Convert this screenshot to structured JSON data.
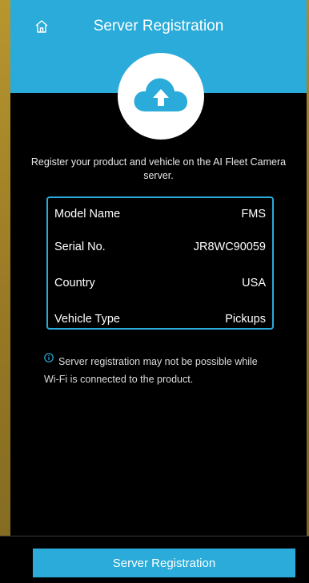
{
  "header": {
    "title": "Server Registration",
    "home_icon": "home-icon"
  },
  "upload_icon": "cloud-upload-icon",
  "intro_text": "Register your product and vehicle on the AI Fleet Camera server.",
  "info": {
    "rows": [
      {
        "label": "Model Name",
        "value": "FMS"
      },
      {
        "label": "Serial No.",
        "value": "JR8WC90059"
      },
      {
        "label": "Country",
        "value": "USA"
      },
      {
        "label": "Vehicle Type",
        "value": "Pickups"
      }
    ]
  },
  "notice": {
    "icon": "info-icon",
    "line1": "Server registration may not be possible while",
    "line2": "Wi-Fi is connected to the product."
  },
  "bottom_button": {
    "label": "Server Registration"
  },
  "colors": {
    "accent": "#2aabd9",
    "background": "#000000",
    "frame": "#b8962f"
  }
}
